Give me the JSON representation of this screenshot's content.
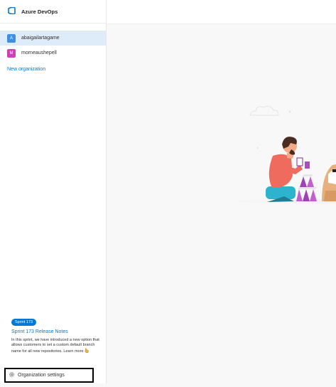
{
  "brand": {
    "name": "Azure DevOps",
    "color": "#0078d4"
  },
  "organizations": [
    {
      "initial": "A",
      "name": "abaigailartagame",
      "color": "#3f8fe0",
      "selected": true
    },
    {
      "initial": "M",
      "name": "morneaushepell",
      "color": "#d03fba",
      "selected": false
    }
  ],
  "new_org_label": "New organization",
  "release_notes": {
    "badge": "Sprint 173",
    "title": "Sprint 173 Release Notes",
    "body": "In this sprint, we have introduced a new option that allows customers to set a custom default branch name for all new repositories.",
    "learn_more": "Learn more"
  },
  "org_settings_label": "Organization settings",
  "accent_color": "#0078d4",
  "selected_bg": "#deecf9"
}
